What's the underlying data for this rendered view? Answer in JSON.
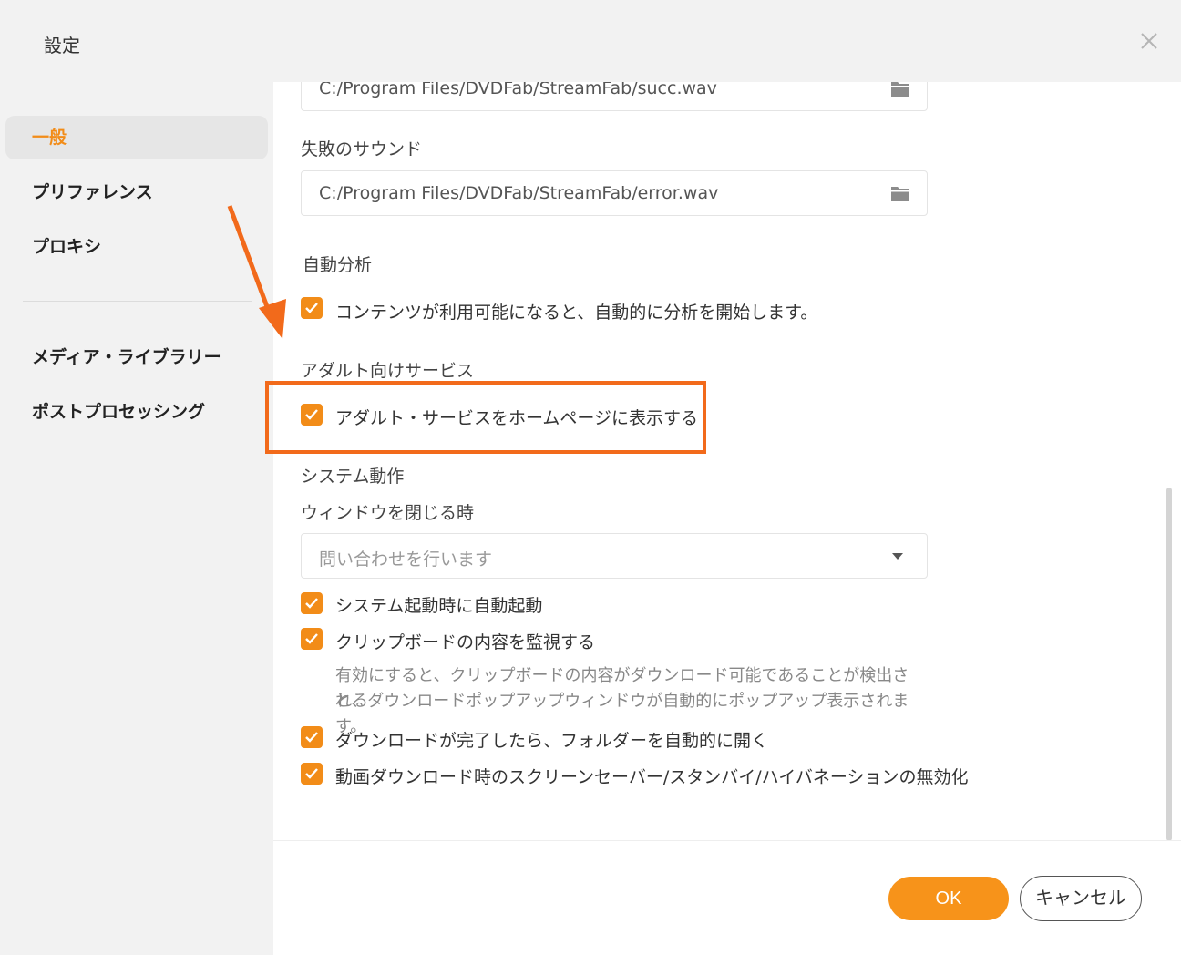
{
  "window": {
    "title": "設定"
  },
  "colors": {
    "accent": "#f28c18",
    "annotation": "#f26a1b",
    "sidebar_bg": "#f2f2f2"
  },
  "sidebar": {
    "items": [
      {
        "label": "一般",
        "active": true
      },
      {
        "label": "プリファレンス",
        "active": false
      },
      {
        "label": "プロキシ",
        "active": false
      },
      {
        "label": "メディア・ライブラリー",
        "active": false
      },
      {
        "label": "ポストプロセッシング",
        "active": false
      }
    ]
  },
  "general": {
    "success_sound_path": "C:/Program Files/DVDFab/StreamFab/succ.wav",
    "failure_sound_label": "失敗のサウンド",
    "failure_sound_path": "C:/Program Files/DVDFab/StreamFab/error.wav",
    "auto_analysis": {
      "heading": "自動分析",
      "option_label": "コンテンツが利用可能になると、自動的に分析を開始します。",
      "checked": true
    },
    "adult": {
      "heading": "アダルト向けサービス",
      "option_label": "アダルト・サービスをホームページに表示する",
      "checked": true
    },
    "system": {
      "heading": "システム動作",
      "window_close_label": "ウィンドウを閉じる時",
      "window_close_value": "問い合わせを行います",
      "options": [
        {
          "label": "システム起動時に自動起動",
          "checked": true
        },
        {
          "label": "クリップボードの内容を監視する",
          "checked": true
        },
        {
          "label": "ダウンロードが完了したら、フォルダーを自動的に開く",
          "checked": true
        },
        {
          "label": "動画ダウンロード時のスクリーンセーバー/スタンバイ/ハイバネーションの無効化",
          "checked": true
        }
      ],
      "clipboard_hint_line1": "有効にすると、クリップボードの内容がダウンロード可能であることが検出される",
      "clipboard_hint_line2": "と、ダウンロードポップアップウィンドウが自動的にポップアップ表示されます。"
    }
  },
  "buttons": {
    "ok": "OK",
    "cancel": "キャンセル"
  },
  "icons": {
    "close": "close-icon",
    "folder": "folder-icon",
    "check": "checkmark-icon",
    "dropdown": "chevron-down-icon"
  }
}
